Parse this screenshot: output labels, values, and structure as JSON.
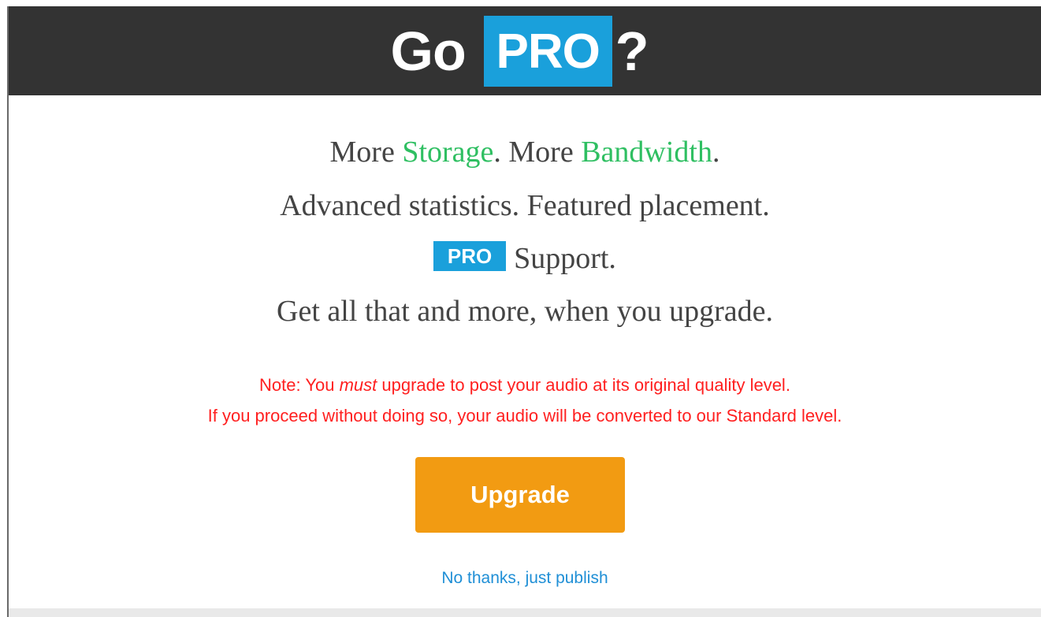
{
  "header": {
    "title_prefix": "Go",
    "title_badge": "PRO",
    "title_suffix": "?"
  },
  "features": {
    "line1": {
      "part1": "More ",
      "storage": "Storage",
      "part2": ". More ",
      "bandwidth": "Bandwidth",
      "part3": "."
    },
    "line2": "Advanced statistics. Featured placement.",
    "line3": {
      "badge": "PRO",
      "text": "Support."
    },
    "line4": "Get all that and more, when you upgrade."
  },
  "note": {
    "line1_part1": "Note: You ",
    "line1_em": "must",
    "line1_part2": " upgrade to post your audio at its original quality level.",
    "line2": "If you proceed without doing so, your audio will be converted to our Standard level."
  },
  "actions": {
    "upgrade_label": "Upgrade",
    "skip_label": "No thanks, just publish"
  },
  "colors": {
    "header_bg": "#333333",
    "badge_blue": "#1aa0db",
    "highlight_green": "#2fbf62",
    "note_red": "#ff1f1f",
    "button_orange": "#f29b12",
    "link_blue": "#1f8fd6"
  }
}
